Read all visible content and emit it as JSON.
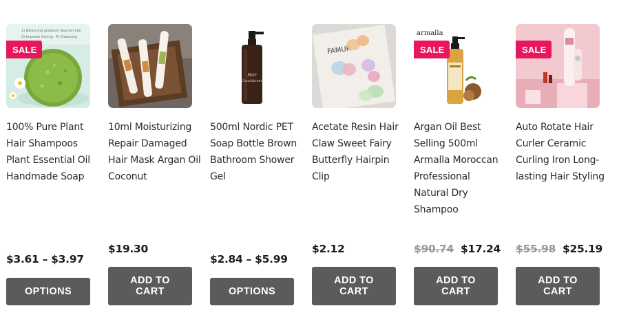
{
  "products": [
    {
      "title": "100% Pure Plant Hair Shampoos Plant Essential Oil Handmade Soap",
      "sale": "SALE",
      "price": "$3.61 – $3.97",
      "button": "OPTIONS",
      "thumb_text": [
        "1) Balancing grease",
        "2) Nourish hair",
        "3) Improve itching",
        "4) Cleansing"
      ]
    },
    {
      "title": "10ml Moisturizing Repair Damaged Hair Mask Argan Oil Coconut",
      "price": "$19.30",
      "button": "ADD TO CART"
    },
    {
      "title": "500ml Nordic PET Soap Bottle Brown Bathroom Shower Gel",
      "price": "$2.84 – $5.99",
      "button": "OPTIONS",
      "thumb_text": [
        "Hair",
        "Conditioner"
      ]
    },
    {
      "title": "Acetate Resin Hair Claw Sweet Fairy Butterfly Hairpin Clip",
      "price": "$2.12",
      "button": "ADD TO CART",
      "thumb_text": [
        "FAMUR"
      ]
    },
    {
      "title": "Argan Oil Best Selling 500ml Armalla Moroccan Professional Natural Dry Shampoo",
      "sale": "SALE",
      "old_price": "$90.74",
      "price": "$17.24",
      "button": "ADD TO CART",
      "thumb_text": [
        "armalla"
      ]
    },
    {
      "title": "Auto Rotate Hair Curler Ceramic Curling Iron Long-lasting Hair Styling",
      "sale": "SALE",
      "old_price": "$55.98",
      "price": "$25.19",
      "button": "ADD TO CART"
    }
  ],
  "colors": {
    "sale_badge": "#e8175d",
    "button_bg": "#5b5b5b",
    "button_text": "#ffffff",
    "old_price": "#9a9a9a"
  }
}
